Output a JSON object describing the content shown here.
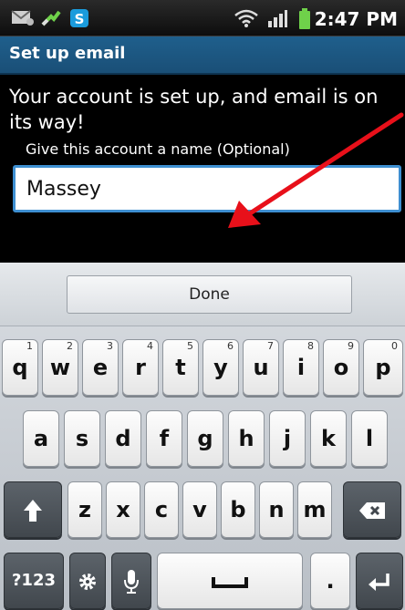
{
  "status_bar": {
    "time": "2:47 PM",
    "icons": [
      "mail-notification-icon",
      "usb-debugging-icon",
      "skype-icon",
      "wifi-icon",
      "signal-icon",
      "battery-icon"
    ]
  },
  "title_bar": {
    "title": "Set up email"
  },
  "content": {
    "message": "Your account is set up, and email is on its way!",
    "field_label": "Give this account a name (Optional)",
    "account_name_value": "Massey",
    "account_name_placeholder": ""
  },
  "keyboard": {
    "done_label": "Done",
    "row1": [
      {
        "label": "q",
        "sub": "1"
      },
      {
        "label": "w",
        "sub": "2"
      },
      {
        "label": "e",
        "sub": "3"
      },
      {
        "label": "r",
        "sub": "4"
      },
      {
        "label": "t",
        "sub": "5"
      },
      {
        "label": "y",
        "sub": "6"
      },
      {
        "label": "u",
        "sub": "7"
      },
      {
        "label": "i",
        "sub": "8"
      },
      {
        "label": "o",
        "sub": "9"
      },
      {
        "label": "p",
        "sub": "0"
      }
    ],
    "row2": [
      "a",
      "s",
      "d",
      "f",
      "g",
      "h",
      "j",
      "k",
      "l"
    ],
    "row3": [
      "z",
      "x",
      "c",
      "v",
      "b",
      "n",
      "m"
    ],
    "symbols_label": "?123",
    "period_label": ".",
    "shift_icon": "shift-arrow-icon",
    "delete_icon": "backspace-icon",
    "settings_icon": "gear-icon",
    "mic_icon": "microphone-icon",
    "space_icon": "space-bar-icon",
    "enter_icon": "enter-arrow-icon"
  },
  "colors": {
    "title_bar": "#1f5f8c",
    "input_border": "#3e8fd1",
    "annotation_arrow": "#e8101a"
  }
}
